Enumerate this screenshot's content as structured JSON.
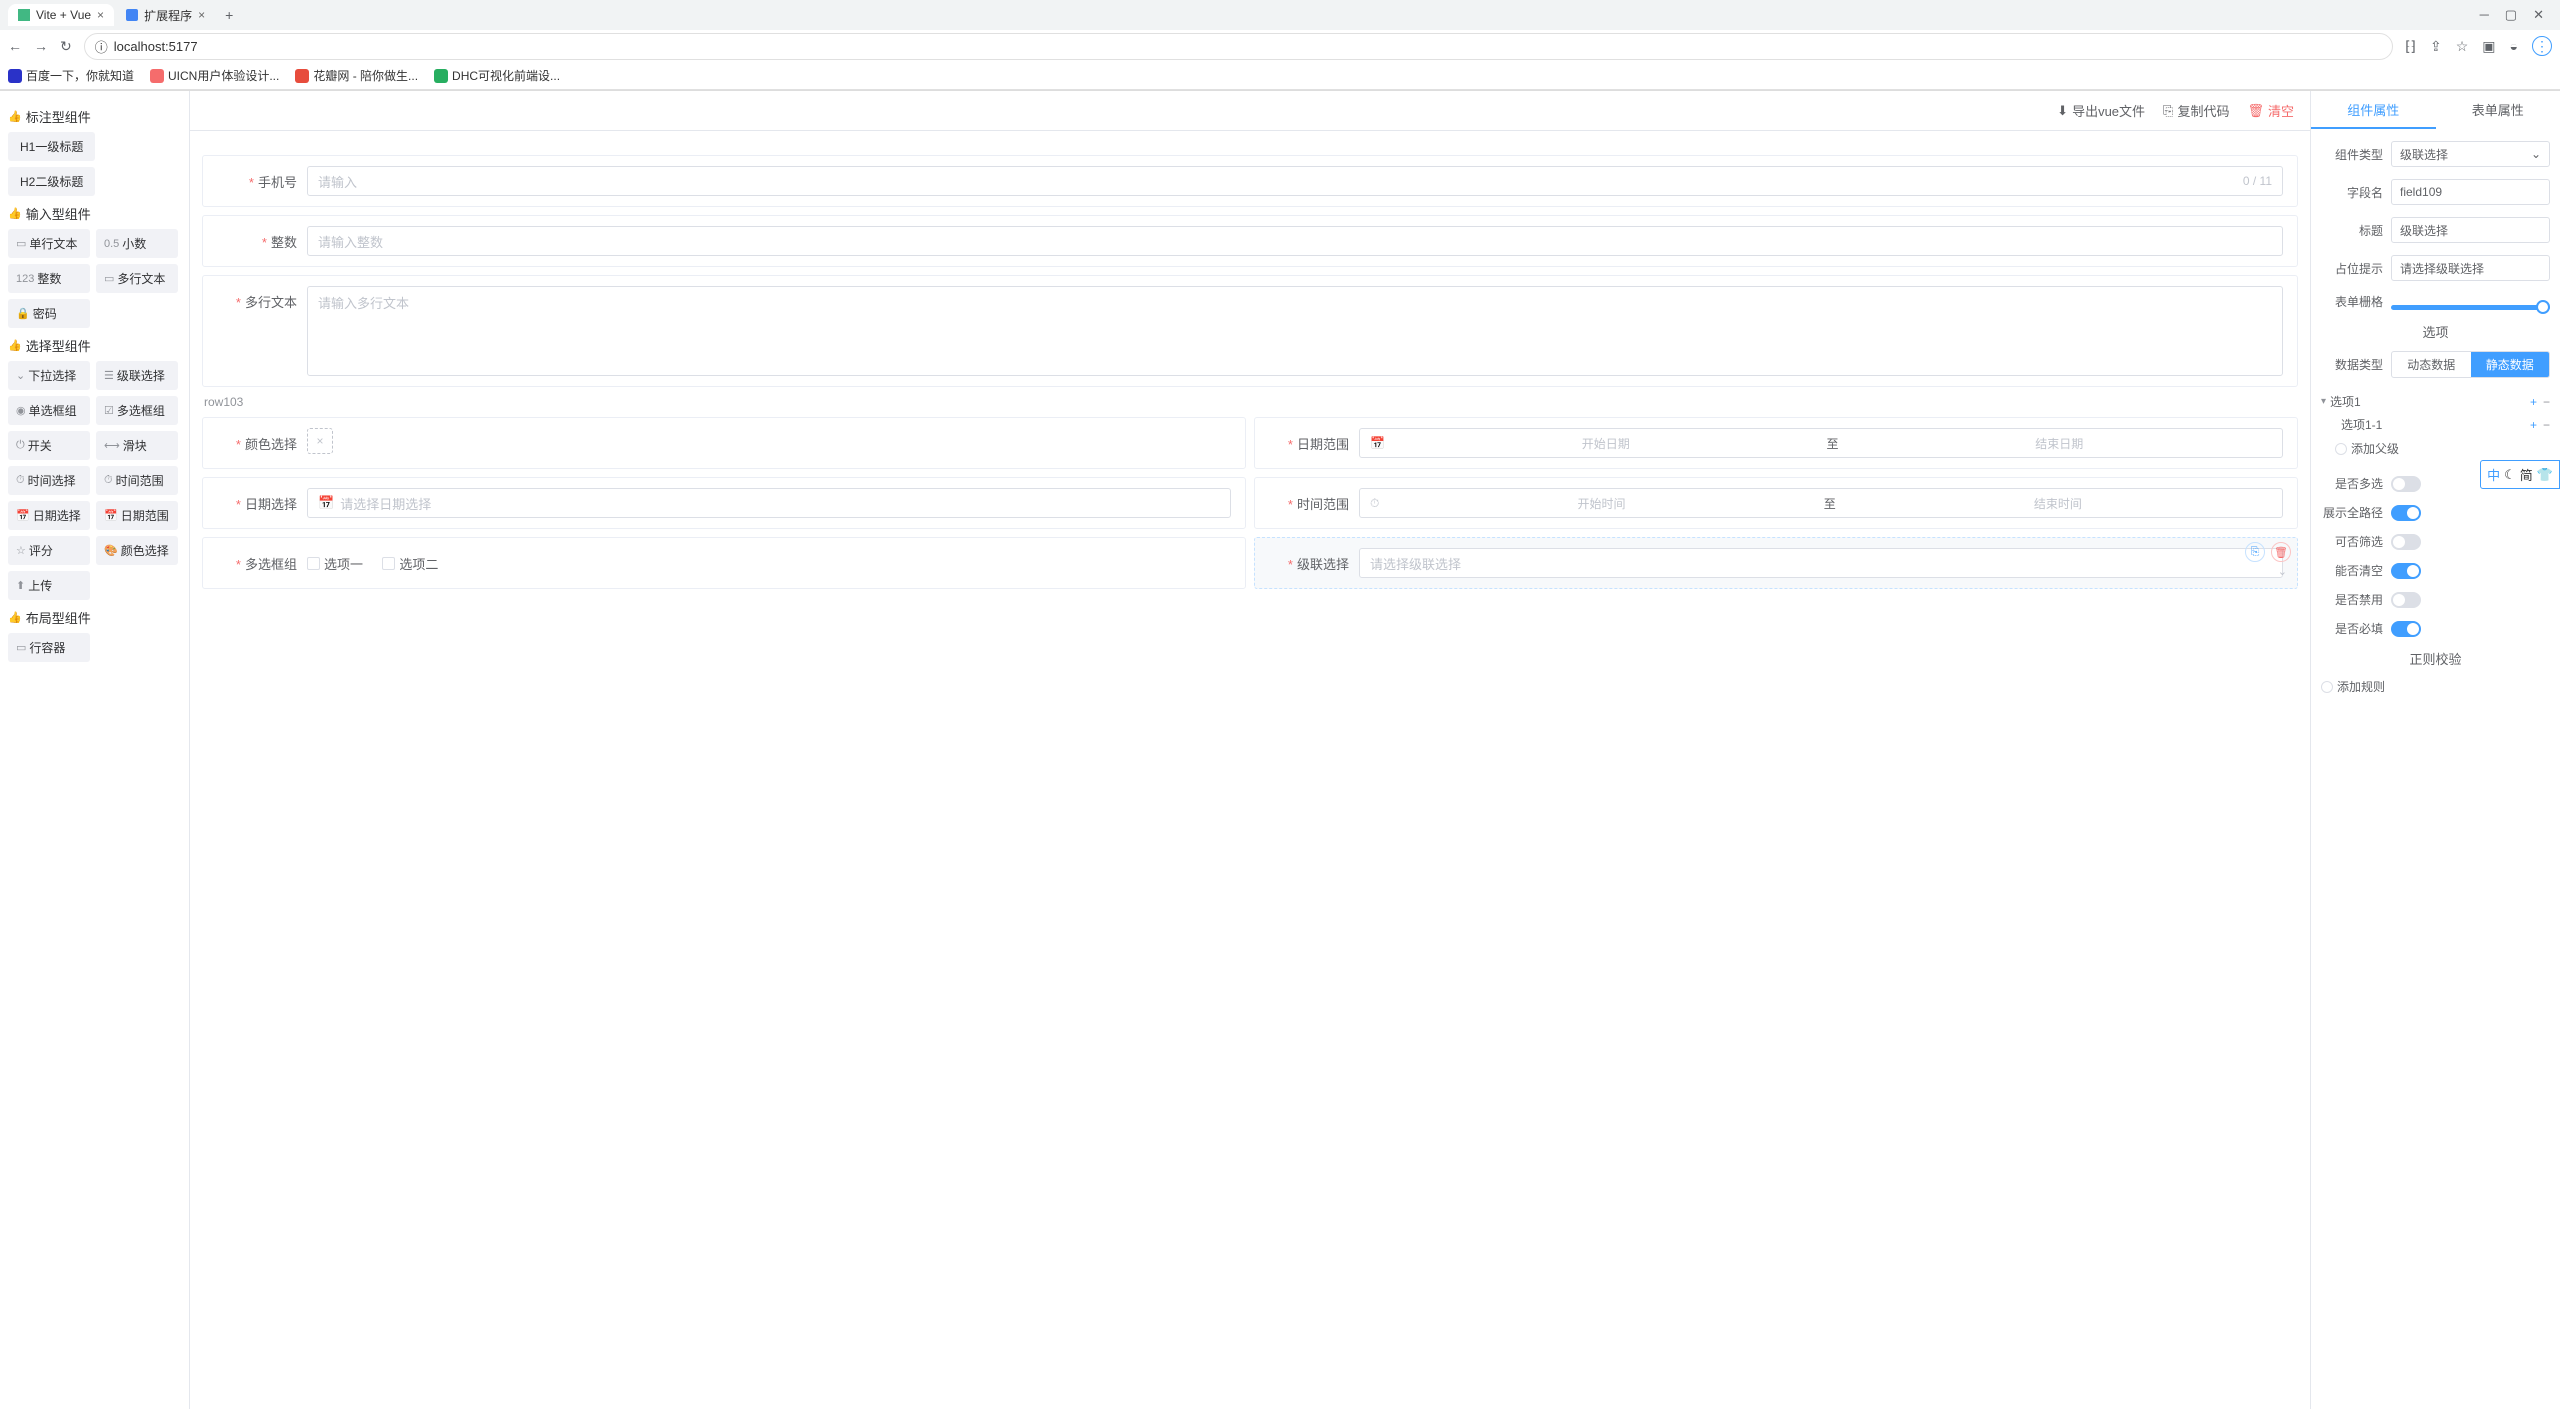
{
  "browser": {
    "tabs": [
      {
        "title": "Vite + Vue",
        "active": true,
        "favicon": "#41b883"
      },
      {
        "title": "扩展程序",
        "active": false,
        "favicon": "#4285f4"
      }
    ],
    "url_prefix": "localhost:",
    "url_port": "5177",
    "bookmarks": [
      {
        "label": "百度一下，你就知道",
        "color": "#2a32c8"
      },
      {
        "label": "UICN用户体验设计...",
        "color": "#f56c6c"
      },
      {
        "label": "花瓣网 - 陪你做生...",
        "color": "#e74c3c"
      },
      {
        "label": "DHC可视化前端设...",
        "color": "#27ae60"
      }
    ]
  },
  "actions": {
    "export": "导出vue文件",
    "copy": "复制代码",
    "clear": "清空"
  },
  "component_palette": {
    "groups": [
      {
        "title": "标注型组件",
        "items": [
          "H1一级标题",
          "H2二级标题"
        ]
      },
      {
        "title": "输入型组件",
        "items": [
          "单行文本",
          "小数",
          "整数",
          "多行文本",
          "密码"
        ]
      },
      {
        "title": "选择型组件",
        "items": [
          "下拉选择",
          "级联选择",
          "单选框组",
          "多选框组",
          "开关",
          "滑块",
          "时间选择",
          "时间范围",
          "日期选择",
          "日期范围",
          "评分",
          "颜色选择",
          "上传"
        ]
      },
      {
        "title": "布局型组件",
        "items": [
          "行容器"
        ]
      }
    ]
  },
  "form": {
    "phone": {
      "label": "手机号",
      "placeholder": "请输入",
      "counter": "0 / 11"
    },
    "integer": {
      "label": "整数",
      "placeholder": "请输入整数"
    },
    "textarea": {
      "label": "多行文本",
      "placeholder": "请输入多行文本"
    },
    "row103_label": "row103",
    "color": {
      "label": "颜色选择"
    },
    "daterange": {
      "label": "日期范围",
      "start": "开始日期",
      "sep": "至",
      "end": "结束日期"
    },
    "datepick": {
      "label": "日期选择",
      "placeholder": "请选择日期选择"
    },
    "timerange": {
      "label": "时间范围",
      "start": "开始时间",
      "sep": "至",
      "end": "结束时间"
    },
    "checkgroup": {
      "label": "多选框组",
      "opts": [
        "选项一",
        "选项二"
      ]
    },
    "cascader": {
      "label": "级联选择",
      "placeholder": "请选择级联选择"
    }
  },
  "right_panel": {
    "tabs": {
      "comp": "组件属性",
      "form": "表单属性"
    },
    "type_label": "组件类型",
    "type_value": "级联选择",
    "field_label": "字段名",
    "field_value": "field109",
    "title_label": "标题",
    "title_value": "级联选择",
    "placeholder_label": "占位提示",
    "placeholder_value": "请选择级联选择",
    "span_label": "表单栅格",
    "options_title": "选项",
    "data_type_label": "数据类型",
    "data_type_opts": {
      "dynamic": "动态数据",
      "static": "静态数据"
    },
    "tree": {
      "opt1": "选项1",
      "opt11": "选项1-1",
      "add_parent": "添加父级"
    },
    "switches": {
      "multi": "是否多选",
      "fullpath": "展示全路径",
      "filterable": "可否筛选",
      "clearable": "能否清空",
      "disabled": "是否禁用",
      "required": "是否必填"
    },
    "regex_title": "正则校验",
    "add_rule": "添加规则"
  },
  "ime": {
    "zh": "中",
    "jian": "简"
  }
}
